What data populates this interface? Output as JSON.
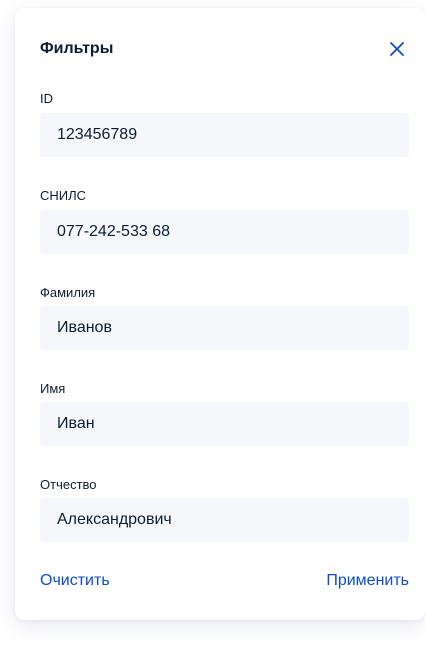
{
  "header": {
    "title": "Фильтры",
    "close_icon": "close-icon"
  },
  "fields": [
    {
      "label": "ID",
      "value": "123456789"
    },
    {
      "label": "СНИЛС",
      "value": "077-242-533 68"
    },
    {
      "label": "Фамилия",
      "value": "Иванов"
    },
    {
      "label": "Имя",
      "value": "Иван"
    },
    {
      "label": "Отчество",
      "value": "Александрович"
    }
  ],
  "actions": {
    "clear_label": "Очистить",
    "apply_label": "Применить"
  },
  "colors": {
    "accent": "#0d4cd3",
    "text": "#0b1f33",
    "input_bg": "#f5f7fa"
  }
}
